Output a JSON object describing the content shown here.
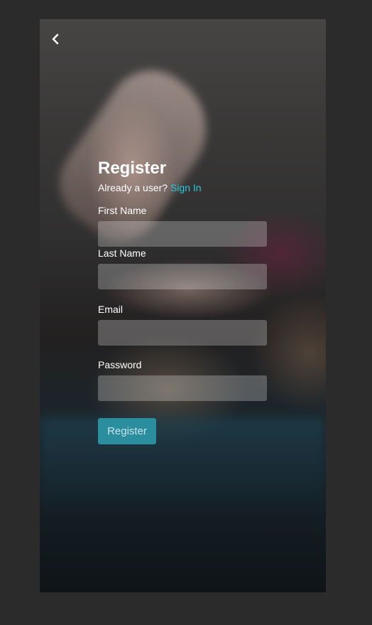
{
  "header": {
    "back_icon": "chevron-left-icon"
  },
  "form": {
    "title": "Register",
    "signin_prompt": "Already a user?",
    "signin_link": "Sign In",
    "fields": [
      {
        "label": "First Name",
        "value": "",
        "placeholder": ""
      },
      {
        "label": "Last Name",
        "value": "",
        "placeholder": ""
      },
      {
        "label": "Email",
        "value": "",
        "placeholder": ""
      },
      {
        "label": "Password",
        "value": "",
        "placeholder": ""
      }
    ],
    "submit_label": "Register"
  },
  "colors": {
    "accent_link": "#29c8dc",
    "button_bg": "#2a8e9f",
    "page_bg": "#2b2b2b"
  }
}
